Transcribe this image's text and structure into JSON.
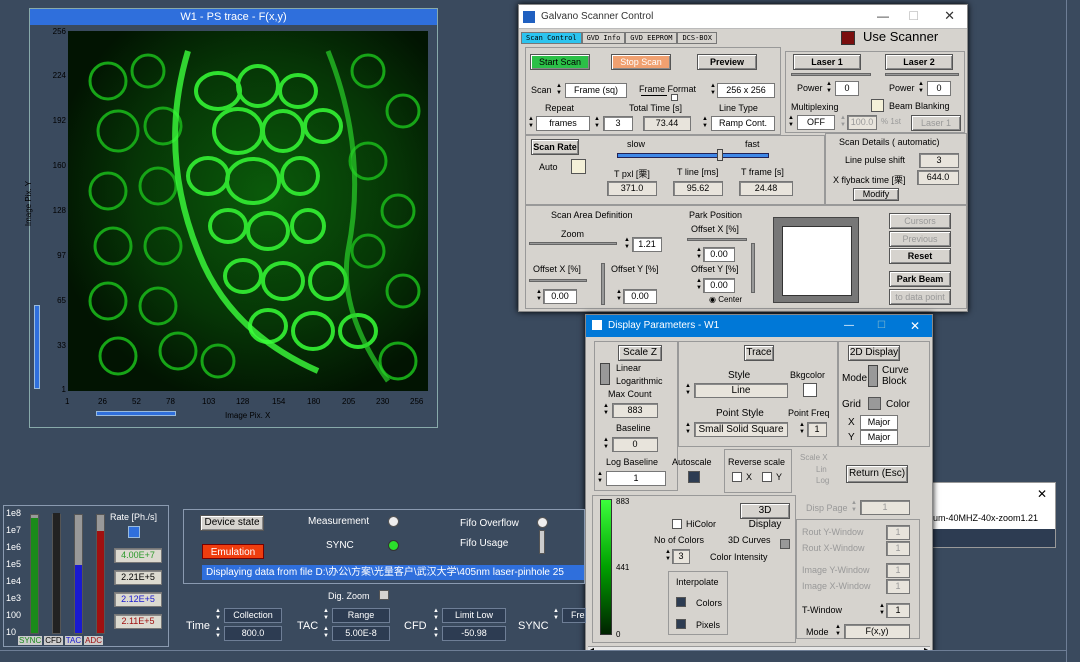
{
  "trace_window": {
    "title": "W1 - PS trace  -  F(x,y)",
    "y_label": "Image Pix. Y",
    "x_label": "Image Pix. X",
    "y_ticks": [
      "256",
      "224",
      "192",
      "160",
      "128",
      "97",
      "65",
      "33",
      "1"
    ],
    "x_ticks": [
      "1",
      "26",
      "52",
      "78",
      "103",
      "128",
      "154",
      "180",
      "205",
      "230",
      "256"
    ]
  },
  "galvano": {
    "title": "Galvano Scanner Control",
    "tabs": [
      "Scan Control",
      "GVD Info",
      "GVD EEPROM",
      "DCS-BOX"
    ],
    "use_scanner": "Use Scanner",
    "start_scan": "Start Scan",
    "stop_scan": "Stop Scan",
    "preview": "Preview",
    "laser1": "Laser 1",
    "laser2": "Laser 2",
    "power_label": "Power",
    "power1": "0",
    "power2": "0",
    "scan_label": "Scan",
    "scan_value": "Frame (sq)",
    "frame_format_label": "Frame Format",
    "frame_format_value": "256 x 256",
    "repeat_label": "Repeat",
    "repeat_unit": "frames",
    "repeat_value": "3",
    "total_time_label": "Total Time [s]",
    "total_time_value": "73.44",
    "line_type_label": "Line Type",
    "line_type_value": "Ramp Cont.",
    "multiplexing_label": "Multiplexing",
    "multiplexing_value": "OFF",
    "mux_pct": "100.0",
    "pct_1st": "% 1st",
    "laser1_short": "Laser 1",
    "beam_blanking": "Beam Blanking",
    "scan_rate": "Scan Rate",
    "auto": "Auto",
    "slow": "slow",
    "fast": "fast",
    "tpxl_label": "T pxl [栗]",
    "tpxl_value": "371.0",
    "tline_label": "T line [ms]",
    "tline_value": "95.62",
    "tframe_label": "T frame [s]",
    "tframe_value": "24.48",
    "scan_details": "Scan Details  ( automatic)",
    "line_pulse_shift_label": "Line pulse shift",
    "line_pulse_shift_value": "3",
    "x_flyback_label": "X flyback time [栗]",
    "x_flyback_value": "644.0",
    "modify": "Modify",
    "scan_area_def": "Scan Area Definition",
    "zoom_label": "Zoom",
    "zoom_value": "1.21",
    "offset_x_label": "Offset X [%]",
    "offset_x_value": "0.00",
    "offset_y_label": "Offset Y [%]",
    "offset_y_value": "0.00",
    "park_position": "Park Position",
    "park_offset_x_label": "Offset X [%]",
    "park_offset_x_value": "0.00",
    "park_offset_y_label": "Offset Y [%]",
    "park_offset_y_value": "0.00",
    "center": "Center",
    "cursors": "Cursors",
    "previous": "Previous",
    "reset": "Reset",
    "park_beam": "Park Beam",
    "to_data_point": "to data point"
  },
  "display_params": {
    "title": "Display Parameters - W1",
    "scale_z": "Scale Z",
    "linear": "Linear",
    "logarithmic": "Logarithmic",
    "max_count_label": "Max Count",
    "max_count_value": "883",
    "baseline_label": "Baseline",
    "baseline_value": "0",
    "log_baseline_label": "Log Baseline",
    "log_baseline_value": "1",
    "autoscale": "Autoscale",
    "trace": "Trace",
    "style_label": "Style",
    "style_value": "Line",
    "bkgcolor": "Bkgcolor",
    "point_style_label": "Point Style",
    "point_style_value": "Small Solid Square",
    "point_freq_label": "Point Freq",
    "point_freq_value": "1",
    "display_2d": "2D Display",
    "mode_label": "Mode",
    "curve": "Curve",
    "block": "Block",
    "grid": "Grid",
    "color": "Color",
    "x_label": "X",
    "y_label": "Y",
    "x_value": "Major",
    "y_value": "Major",
    "reverse_scale": "Reverse scale",
    "rx": "X",
    "ry": "Y",
    "scale_x": "Scale X",
    "lin": "Lin",
    "log": "Log",
    "return_esc": "Return (Esc)",
    "bar_max": "883",
    "bar_mid": "441",
    "bar_min": "0",
    "display_3d": "3D Display",
    "hicolor": "HiColor",
    "no_colors_label": "No of Colors",
    "no_colors_value": "3",
    "curves_3d": "3D Curves",
    "color_intensity": "Color Intensity",
    "interpolate": "Interpolate",
    "colors": "Colors",
    "pixels": "Pixels",
    "disp_page": "Disp Page",
    "disp_page_value": "1",
    "rout_y": "Rout Y-Window",
    "rout_x": "Rout X-Window",
    "image_y": "Image Y-Window",
    "image_x": "Image X-Window",
    "rout_y_value": "1",
    "rout_x_value": "1",
    "image_y_value": "1",
    "image_x_value": "1",
    "t_window_label": "T-Window",
    "t_window_value": "1",
    "mode2_label": "Mode",
    "mode2_value": "F(x,y)"
  },
  "bg_window": {
    "text": "um-40MHZ-40x-zoom1.21"
  },
  "rate_panel": {
    "rate_label": "Rate [Ph./s]",
    "rows": [
      "1e8",
      "1e7",
      "1e6",
      "1e5",
      "1e4",
      "1e3",
      "100",
      "10"
    ],
    "sync_value": "4.00E+7",
    "cfd_value": "2.21E+5",
    "tac_value": "2.12E+5",
    "adc_value": "2.11E+5",
    "labels": [
      "SYNC",
      "CFD",
      "TAC",
      "ADC"
    ],
    "bar_colors": [
      "#1a8a1a",
      "#222222",
      "#1a1ad0",
      "#a01010"
    ]
  },
  "device_state": {
    "label": "Device state",
    "state": "Emulation",
    "measurement": "Measurement",
    "sync": "SYNC",
    "fifo_overflow": "Fifo Overflow",
    "fifo_usage": "Fifo Usage",
    "status": "Displaying data from file D:\\办公\\方案\\光量客户\\武汉大学\\405nm laser-pinhole 25"
  },
  "bottom": {
    "dig_zoom": "Dig. Zoom",
    "time_label": "Time",
    "time_mode": "Collection",
    "time_value": "800.0",
    "tac_label": "TAC",
    "tac_mode": "Range",
    "tac_value": "5.00E-8",
    "cfd_label": "CFD",
    "cfd_mode": "Limit Low",
    "cfd_value": "-50.98",
    "sync_label": "SYNC",
    "sync_mode": "Fre"
  }
}
